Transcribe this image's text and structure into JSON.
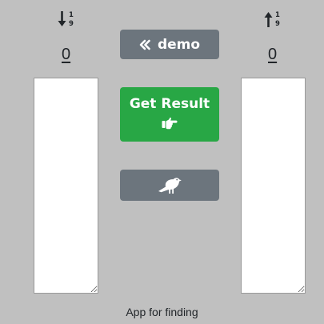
{
  "left_panel": {
    "sort_icon": "sort-numeric-down-icon",
    "count": "0",
    "list_value": ""
  },
  "right_panel": {
    "sort_icon": "sort-numeric-up-icon",
    "count": "0",
    "list_value": ""
  },
  "controls": {
    "demo_button": {
      "label": "demo",
      "icon": "double-chevron-left-icon"
    },
    "result_button": {
      "label": "Get Result",
      "icon": "hand-point-right-icon"
    },
    "bird_button": {
      "icon": "crow-icon"
    }
  },
  "footer": {
    "text": "App for finding"
  },
  "colors": {
    "background": "#c0c0c0",
    "gray_button": "#6c757d",
    "green_button": "#28a745",
    "text": "#212529"
  }
}
